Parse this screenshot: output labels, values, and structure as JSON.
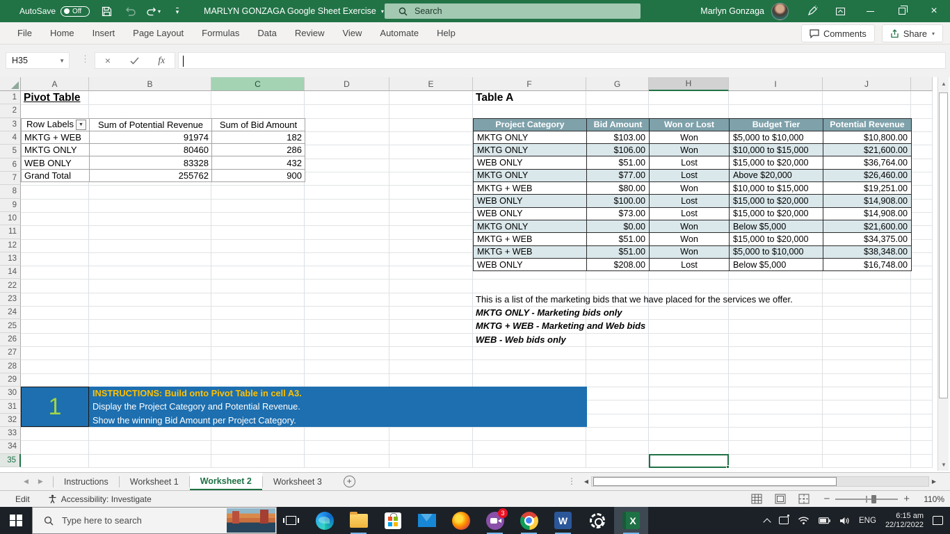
{
  "titlebar": {
    "autosave_label": "AutoSave",
    "autosave_state": "Off",
    "doc_title": "MARLYN GONZAGA Google Sheet Exercise",
    "search_placeholder": "Search",
    "user_name": "Marlyn Gonzaga"
  },
  "ribbon": {
    "tabs": [
      "File",
      "Home",
      "Insert",
      "Page Layout",
      "Formulas",
      "Data",
      "Review",
      "View",
      "Automate",
      "Help"
    ],
    "comments_label": "Comments",
    "share_label": "Share"
  },
  "formula_bar": {
    "cell_ref": "H35",
    "fx_label": "fx",
    "formula_value": ""
  },
  "sheet": {
    "columns": [
      "A",
      "B",
      "C",
      "D",
      "E",
      "F",
      "G",
      "H",
      "I",
      "J"
    ],
    "green_column": "C",
    "gray_column": "H",
    "row_numbers": [
      1,
      2,
      3,
      4,
      5,
      6,
      7,
      8,
      9,
      10,
      11,
      12,
      13,
      14,
      22,
      23,
      24,
      25,
      26,
      27,
      28,
      29,
      30,
      31,
      32,
      33,
      34,
      35
    ],
    "selected_row": 35,
    "a1_title": "Pivot Table",
    "pivot": {
      "headers": [
        "Row Labels",
        "Sum of Potential Revenue",
        "Sum of Bid Amount"
      ],
      "rows": [
        [
          "MKTG + WEB",
          "91974",
          "182"
        ],
        [
          "MKTG ONLY",
          "80460",
          "286"
        ],
        [
          "WEB ONLY",
          "83328",
          "432"
        ],
        [
          "Grand Total",
          "255762",
          "900"
        ]
      ]
    },
    "table_a": {
      "title": "Table A",
      "headers": [
        "Project Category",
        "Bid Amount",
        "Won or Lost",
        "Budget Tier",
        "Potential Revenue"
      ],
      "rows": [
        [
          "MKTG ONLY",
          "$103.00",
          "Won",
          "$5,000 to $10,000",
          "$10,800.00"
        ],
        [
          "MKTG ONLY",
          "$106.00",
          "Won",
          "$10,000 to $15,000",
          "$21,600.00"
        ],
        [
          "WEB ONLY",
          "$51.00",
          "Lost",
          "$15,000 to $20,000",
          "$36,764.00"
        ],
        [
          "MKTG ONLY",
          "$77.00",
          "Lost",
          "Above $20,000",
          "$26,460.00"
        ],
        [
          "MKTG + WEB",
          "$80.00",
          "Won",
          "$10,000 to $15,000",
          "$19,251.00"
        ],
        [
          "WEB ONLY",
          "$100.00",
          "Lost",
          "$15,000 to $20,000",
          "$14,908.00"
        ],
        [
          "WEB ONLY",
          "$73.00",
          "Lost",
          "$15,000 to $20,000",
          "$14,908.00"
        ],
        [
          "MKTG ONLY",
          "$0.00",
          "Won",
          "Below $5,000",
          "$21,600.00"
        ],
        [
          "MKTG + WEB",
          "$51.00",
          "Won",
          "$15,000 to $20,000",
          "$34,375.00"
        ],
        [
          "MKTG + WEB",
          "$51.00",
          "Won",
          "$5,000 to $10,000",
          "$38,348.00"
        ],
        [
          "WEB ONLY",
          "$208.00",
          "Lost",
          "Below $5,000",
          "$16,748.00"
        ]
      ]
    },
    "notes": {
      "intro": "This is a list of the marketing bids that we have placed for the services we offer.",
      "bullets": [
        "MKTG ONLY - Marketing bids only",
        "MKTG + WEB - Marketing and Web bids",
        "WEB - Web bids only"
      ]
    },
    "instructions": {
      "number": "1",
      "heading": "INSTRUCTIONS: Build onto Pivot Table in cell A3.",
      "lines": [
        "Display the Project Category and Potential Revenue.",
        "Show the winning Bid Amount per Project Category."
      ]
    }
  },
  "tab_bar": {
    "tabs": [
      "Instructions",
      "Worksheet 1",
      "Worksheet 2",
      "Worksheet 3"
    ],
    "active_tab": "Worksheet 2"
  },
  "status_bar": {
    "mode": "Edit",
    "accessibility": "Accessibility: Investigate",
    "zoom_level": "110%"
  },
  "taskbar": {
    "search_placeholder": "Type here to search",
    "app_badge": "3",
    "language": "ENG",
    "time": "6:15 am",
    "date": "22/12/2022"
  }
}
